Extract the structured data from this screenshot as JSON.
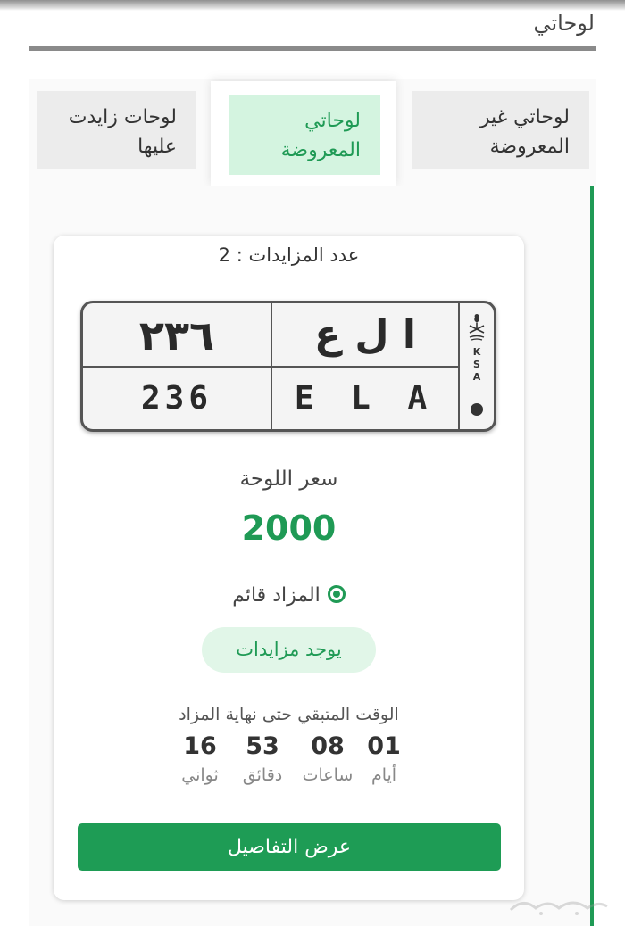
{
  "header": {
    "title": "لوحاتي"
  },
  "tabs": [
    {
      "label": "لوحاتي غير المعروضة",
      "active": false
    },
    {
      "label": "لوحاتي المعروضة",
      "active": true
    },
    {
      "label": "لوحات زايدت عليها",
      "active": false
    }
  ],
  "card": {
    "bids_count": "عدد المزايدات : 2",
    "plate": {
      "arabic_number": "٢٣٦",
      "arabic_letters": "ا ل ع",
      "english_number": "236",
      "english_letters": "E L A",
      "country_code": [
        "K",
        "S",
        "A"
      ]
    },
    "price_label": "سعر اللوحة",
    "price_value": "2000",
    "auction_status": "المزاد قائم",
    "bids_badge": "يوجد مزايدات",
    "time_remaining_label": "الوقت المتبقي حتى نهاية المزاد",
    "countdown": [
      {
        "value": "01",
        "unit": "أيام"
      },
      {
        "value": "08",
        "unit": "ساعات"
      },
      {
        "value": "53",
        "unit": "دقائق"
      },
      {
        "value": "16",
        "unit": "ثواني"
      }
    ],
    "details_button": "عرض التفاصيل"
  },
  "colors": {
    "accent": "#1f9a55",
    "accent_light": "#d4f4e0",
    "pill_bg": "#e1f6e8"
  }
}
